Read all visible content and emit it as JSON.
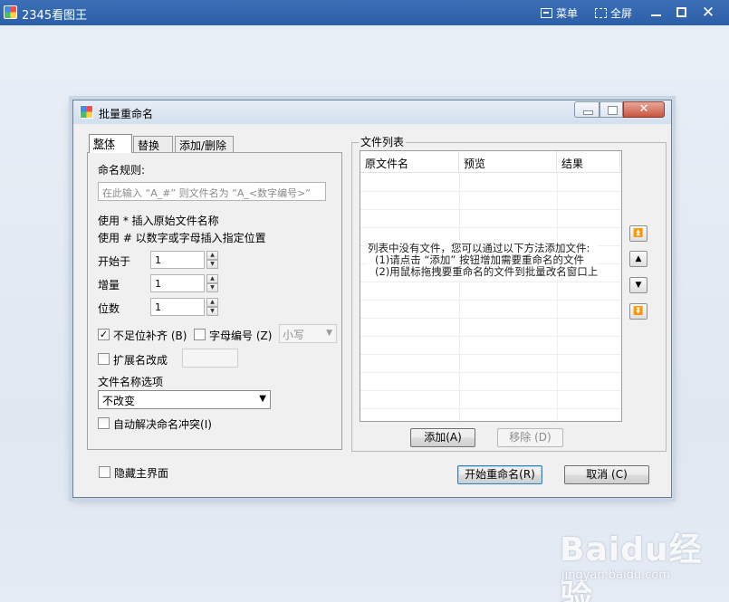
{
  "app": {
    "title": "2345看图王",
    "menu_label": "菜单",
    "fullscreen_label": "全屏",
    "close_glyph": "✕"
  },
  "dialog": {
    "title": "批量重命名",
    "close_glyph": "✕",
    "tabs": [
      {
        "label": "整体",
        "active": true
      },
      {
        "label": "替换",
        "active": false
      },
      {
        "label": "添加/删除",
        "active": false
      }
    ],
    "naming_rule_label": "命名规则:",
    "naming_rule_placeholder": "在此输入 “A_#” 则文件名为 “A_<数字编号>”",
    "hint_1": "使用 * 插入原始文件名称",
    "hint_2": "使用 # 以数字或字母插入指定位置",
    "start_label": "开始于",
    "start_value": "1",
    "increment_label": "增量",
    "increment_value": "1",
    "digits_label": "位数",
    "digits_value": "1",
    "pad_label": "不足位补齐",
    "pad_hotkey": "(B)",
    "pad_checked": true,
    "letter_label": "字母编号",
    "letter_hotkey": "(Z)",
    "letter_checked": false,
    "case_value": "小写",
    "ext_label": "扩展名改成",
    "ext_checked": false,
    "ext_value": "",
    "filename_option_label": "文件名称选项",
    "filename_option_value": "不改变",
    "auto_resolve_label": "自动解决命名冲突",
    "auto_resolve_hotkey": "(I)",
    "auto_resolve_checked": false,
    "file_list_label": "文件列表",
    "columns": [
      "原文件名",
      "预览",
      "结果"
    ],
    "empty_message": [
      "列表中没有文件，您可以通过以下方法添加文件:",
      "(1)请点击 “添加” 按钮增加需要重命名的文件",
      "(2)用鼠标拖拽要重命名的文件到批量改名窗口上"
    ],
    "move_top_glyph": "⏫",
    "move_up_glyph": "▲",
    "move_down_glyph": "▼",
    "move_bottom_glyph": "⏬",
    "add_label": "添加",
    "add_hotkey": "(A)",
    "remove_label": "移除",
    "remove_hotkey": "(D)",
    "hide_main_label": "隐藏主界面",
    "hide_main_checked": false,
    "start_rename_label": "开始重命名",
    "start_rename_hotkey": "(R)",
    "cancel_label": "取消",
    "cancel_hotkey": "(C)"
  },
  "watermark": {
    "logo": "Baidu经验",
    "url": "jingyan.baidu.com"
  },
  "colors": {
    "titlebar": "#2c5fa8",
    "dialog_bg": "#f0f0f0",
    "dialog_close": "#c8553e",
    "accent_border": "#3c7fb1"
  }
}
